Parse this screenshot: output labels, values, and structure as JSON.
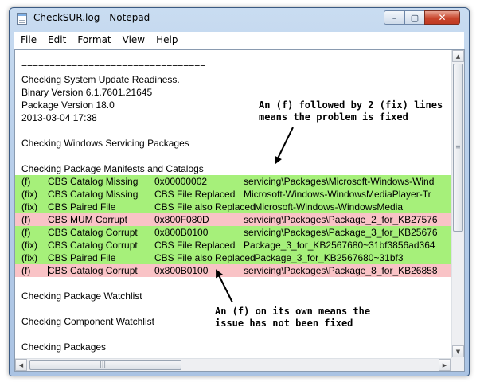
{
  "window": {
    "title": "CheckSUR.log - Notepad",
    "controls": {
      "minimize": "–",
      "maximize": "▢",
      "close": "✕"
    }
  },
  "menu": [
    "File",
    "Edit",
    "Format",
    "View",
    "Help"
  ],
  "document": {
    "header_lines": [
      "=================================",
      "Checking System Update Readiness.",
      "Binary Version 6.1.7601.21645",
      "Package Version 18.0",
      "2013-03-04 17:38",
      "",
      "Checking Windows Servicing Packages",
      "",
      "Checking Package Manifests and Catalogs"
    ],
    "rows": [
      {
        "tag": "(f)",
        "name": "CBS Catalog Missing",
        "code": "0x00000002",
        "path": "servicing\\Packages\\Microsoft-Windows-Wind",
        "highlight": "green"
      },
      {
        "tag": "(fix)",
        "name": "CBS Catalog Missing",
        "code": "CBS File Replaced",
        "path": "Microsoft-Windows-WindowsMediaPlayer-Tr",
        "highlight": "green"
      },
      {
        "tag": "(fix)",
        "name": "CBS Paired File",
        "code": "CBS File also Replaced",
        "path": "    Microsoft-Windows-WindowsMedia",
        "highlight": "green"
      },
      {
        "tag": "(f)",
        "name": "CBS MUM Corrupt",
        "code": "0x800F080D",
        "path": "servicing\\Packages\\Package_2_for_KB27576",
        "highlight": "pink"
      },
      {
        "tag": "(f)",
        "name": "CBS Catalog Corrupt",
        "code": "0x800B0100",
        "path": "servicing\\Packages\\Package_3_for_KB25676",
        "highlight": "green"
      },
      {
        "tag": "(fix)",
        "name": "CBS Catalog Corrupt",
        "code": "CBS File Replaced",
        "path": "Package_3_for_KB2567680~31bf3856ad364",
        "highlight": "green"
      },
      {
        "tag": "(fix)",
        "name": "CBS Paired File",
        "code": "CBS File also Replaced",
        "path": "    Package_3_for_KB2567680~31bf3",
        "highlight": "green"
      },
      {
        "tag": "(f)",
        "name": "CBS Catalog Corrupt",
        "code": "0x800B0100",
        "path": "servicing\\Packages\\Package_8_for_KB26858",
        "highlight": "pink"
      }
    ],
    "footer_lines": [
      "",
      "Checking Package Watchlist",
      "",
      "Checking Component Watchlist",
      "",
      "Checking Packages"
    ]
  },
  "annotations": {
    "fixed": "An (f) followed by 2 (fix) lines\nmeans the problem is fixed",
    "not_fixed": "An (f) on its own means the\nissue has not been fixed"
  },
  "colors": {
    "fixed_row": "#a6f07a",
    "unfixed_row": "#f9c3c6"
  },
  "scrollbar": {
    "up": "▲",
    "down": "▼",
    "left": "◀",
    "right": "▶",
    "grip": "≡",
    "hgrip": "|||"
  }
}
